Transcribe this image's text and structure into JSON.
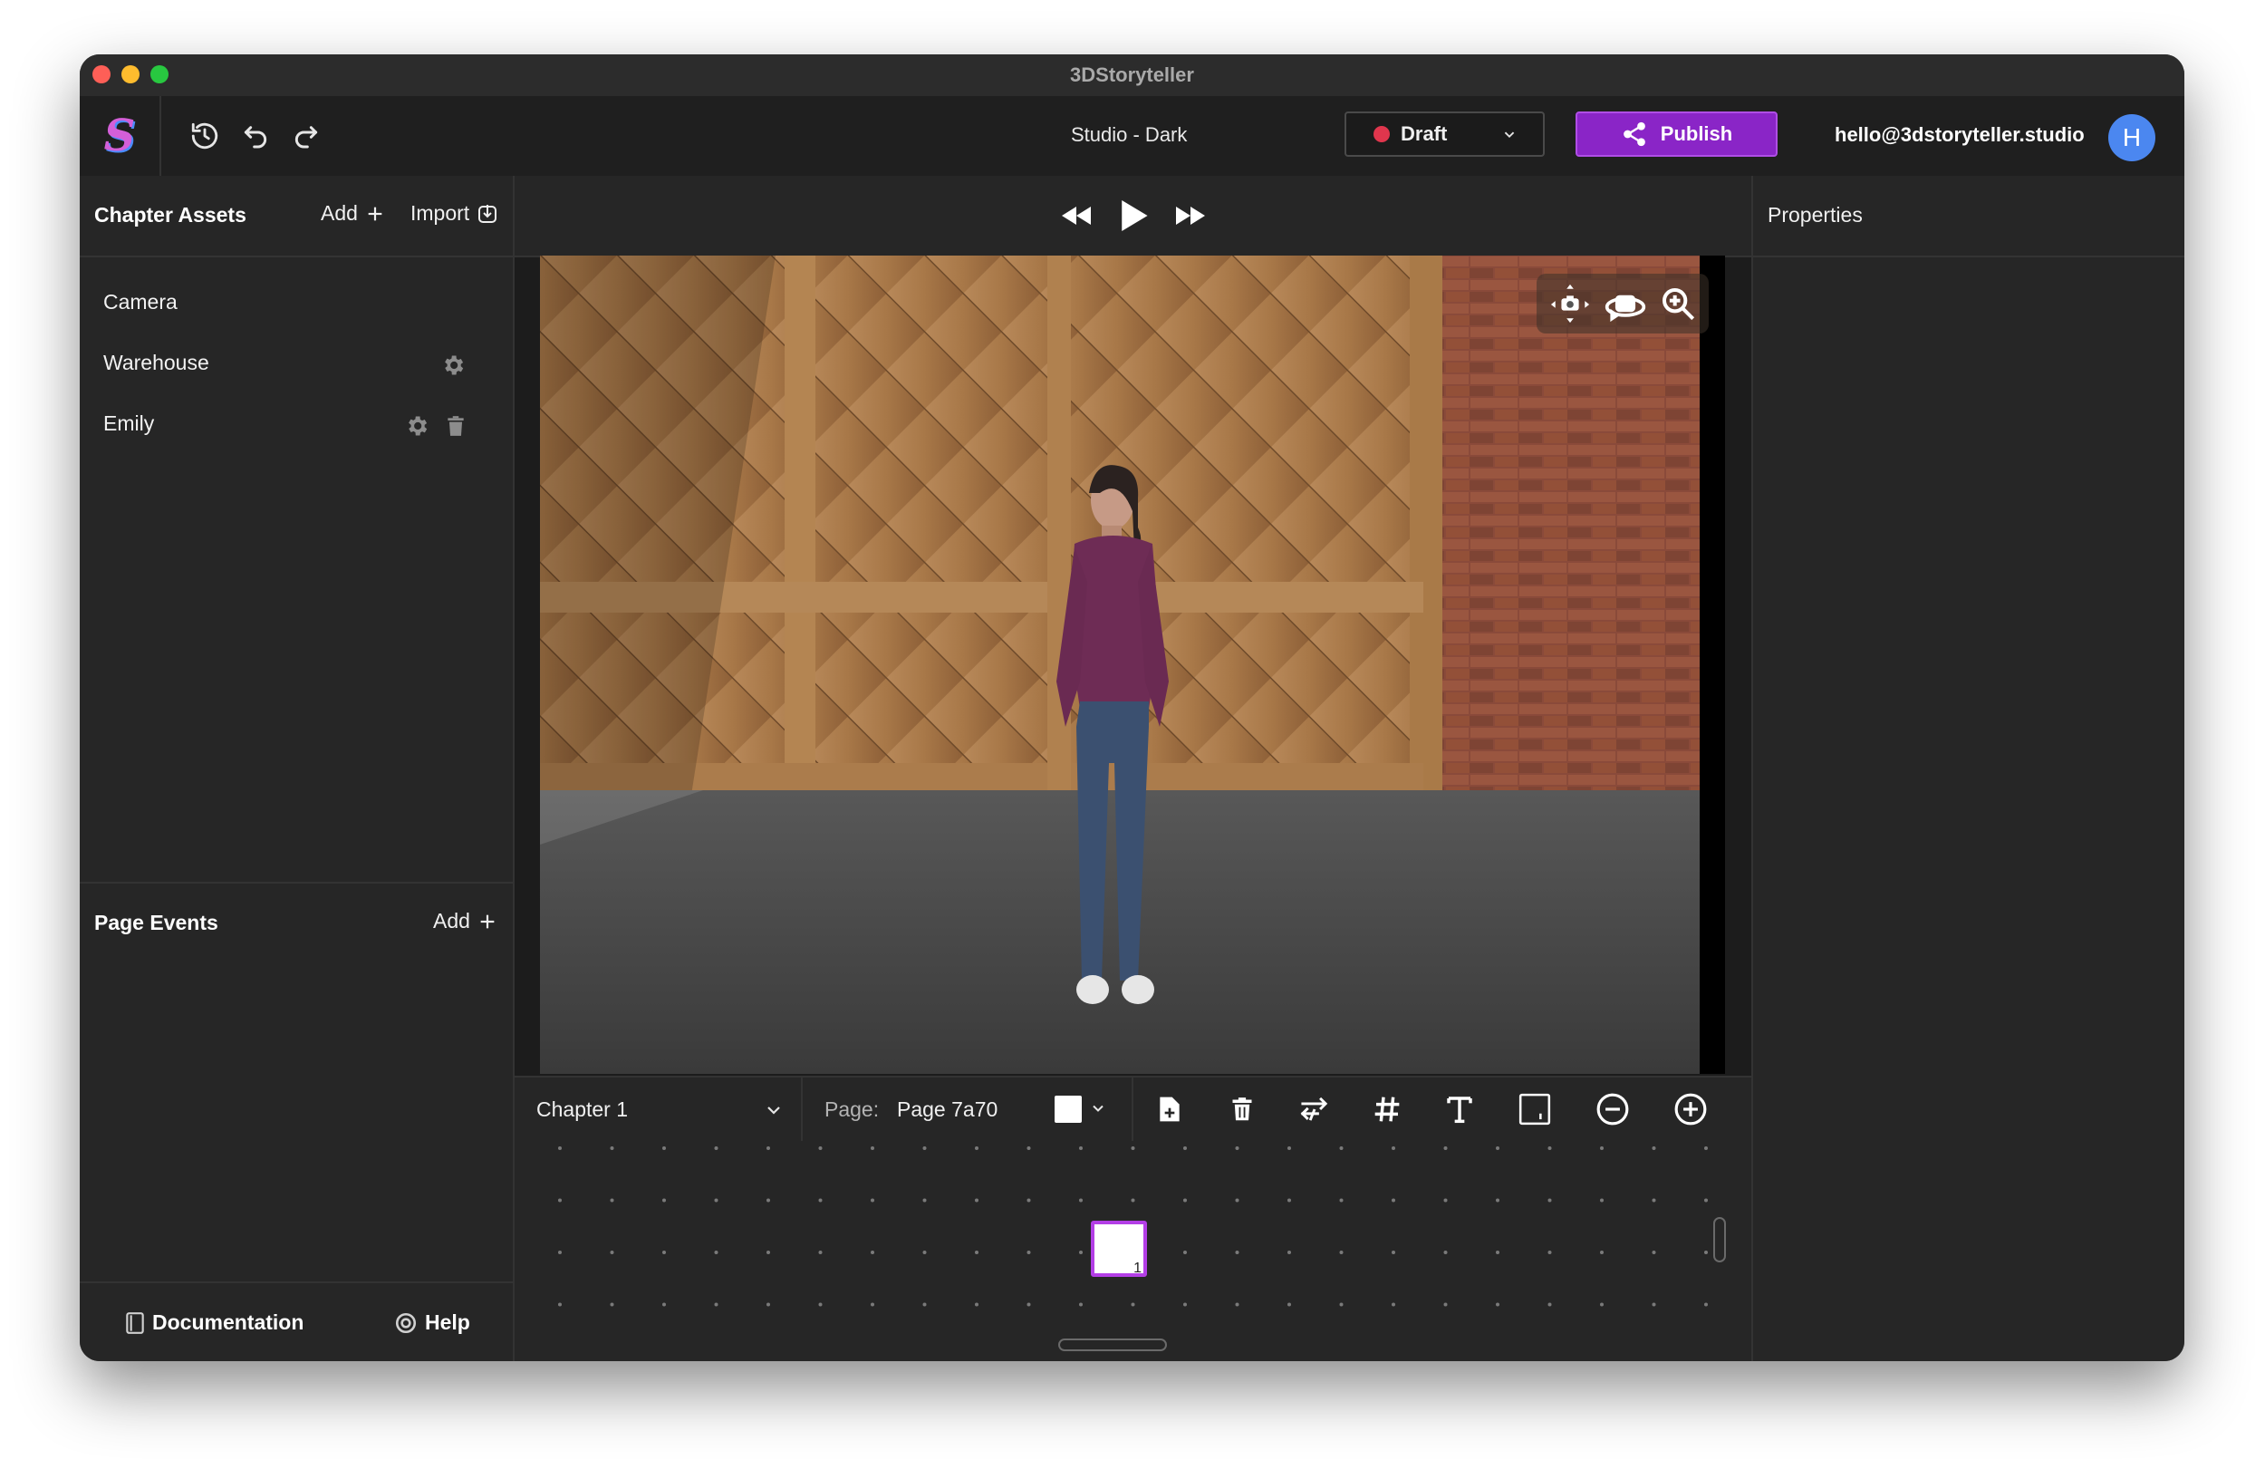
{
  "window": {
    "title": "3DStoryteller"
  },
  "toolbar": {
    "logo": "S",
    "studio_name": "Studio - Dark",
    "status": {
      "label": "Draft",
      "color": "#e0364d"
    },
    "publish_label": "Publish",
    "user_email": "hello@3dstoryteller.studio",
    "avatar_initial": "H"
  },
  "left": {
    "chapter_assets": {
      "title": "Chapter Assets",
      "add_label": "Add",
      "import_label": "Import",
      "items": [
        {
          "label": "Camera",
          "icons": []
        },
        {
          "label": "Warehouse",
          "icons": [
            "gear-icon"
          ]
        },
        {
          "label": "Emily",
          "icons": [
            "gear-icon",
            "trash-icon"
          ]
        }
      ]
    },
    "page_events": {
      "title": "Page Events",
      "add_label": "Add"
    },
    "footer": {
      "documentation_label": "Documentation",
      "help_label": "Help"
    }
  },
  "center": {
    "chapter": "Chapter 1",
    "page_prefix": "Page:",
    "page_value": "Page 7a70",
    "swatch_color": "#ffffff",
    "timeline_page_number": "1"
  },
  "right": {
    "title": "Properties"
  },
  "colors": {
    "accent": "#8a25c7",
    "accent_border": "#b33ee6",
    "avatar": "#4b87f0"
  }
}
